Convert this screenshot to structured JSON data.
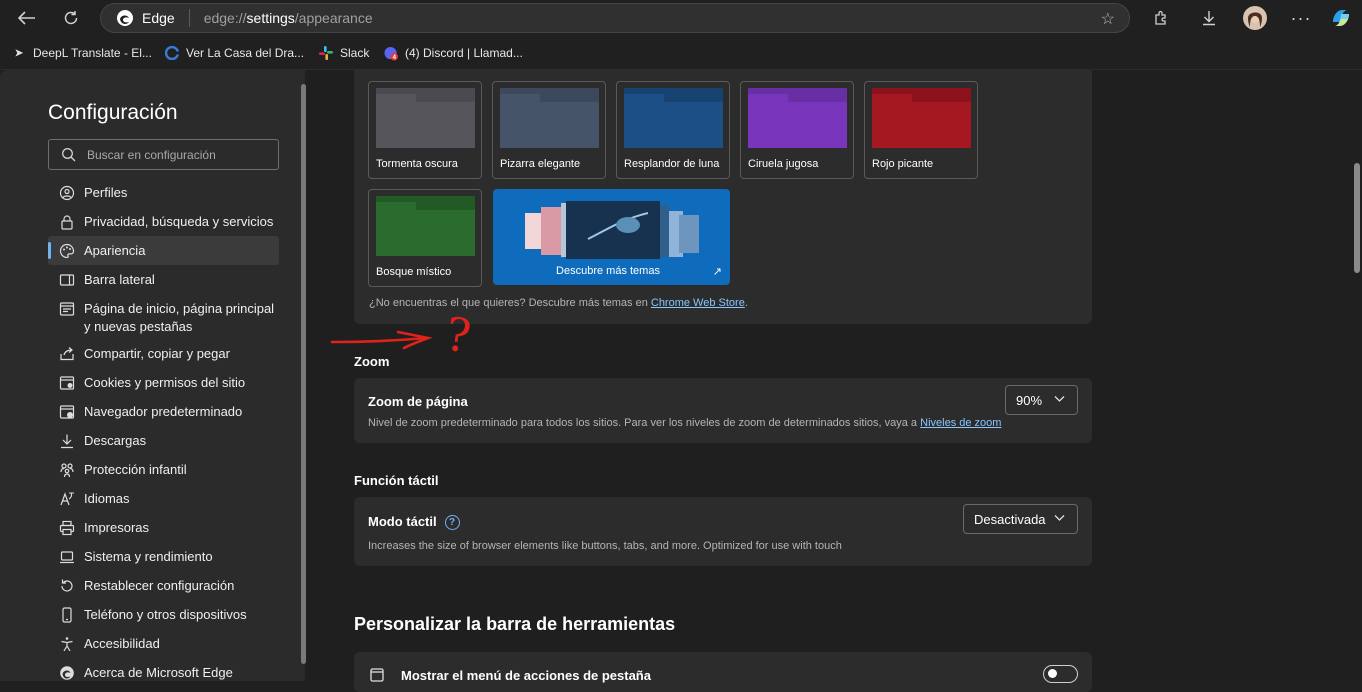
{
  "browser": {
    "brand": "Edge",
    "url_prefix": "edge://",
    "url_bold": "settings",
    "url_rest": "/appearance"
  },
  "favorites": [
    {
      "label": "DeepL Translate - El..."
    },
    {
      "label": "Ver La Casa del Dra..."
    },
    {
      "label": "Slack"
    },
    {
      "label": "(4) Discord | Llamad..."
    }
  ],
  "sidebar": {
    "title": "Configuración",
    "search_placeholder": "Buscar en configuración",
    "items": [
      {
        "label": "Perfiles",
        "icon": "profile-icon"
      },
      {
        "label": "Privacidad, búsqueda y servicios",
        "icon": "lock-icon"
      },
      {
        "label": "Apariencia",
        "icon": "palette-icon",
        "active": true
      },
      {
        "label": "Barra lateral",
        "icon": "sidebar-icon"
      },
      {
        "label": "Página de inicio, página principal y nuevas pestañas",
        "icon": "home-icon"
      },
      {
        "label": "Compartir, copiar y pegar",
        "icon": "share-icon"
      },
      {
        "label": "Cookies y permisos del sitio",
        "icon": "cookie-icon"
      },
      {
        "label": "Navegador predeterminado",
        "icon": "browser-icon"
      },
      {
        "label": "Descargas",
        "icon": "download-icon"
      },
      {
        "label": "Protección infantil",
        "icon": "family-icon"
      },
      {
        "label": "Idiomas",
        "icon": "language-icon"
      },
      {
        "label": "Impresoras",
        "icon": "printer-icon"
      },
      {
        "label": "Sistema y rendimiento",
        "icon": "laptop-icon"
      },
      {
        "label": "Restablecer configuración",
        "icon": "reset-icon"
      },
      {
        "label": "Teléfono y otros dispositivos",
        "icon": "phone-icon"
      },
      {
        "label": "Accesibilidad",
        "icon": "accessibility-icon"
      },
      {
        "label": "Acerca de Microsoft Edge",
        "icon": "edge-icon"
      }
    ]
  },
  "themes": {
    "items": [
      {
        "name": "Tormenta oscura",
        "color": "#55555b",
        "tab": "#4a4a50"
      },
      {
        "name": "Pizarra elegante",
        "color": "#46546a",
        "tab": "#3c485c"
      },
      {
        "name": "Resplandor de luna",
        "color": "#1b4f86",
        "tab": "#174373"
      },
      {
        "name": "Ciruela jugosa",
        "color": "#7a35bd",
        "tab": "#682ea3"
      },
      {
        "name": "Rojo picante",
        "color": "#a51822",
        "tab": "#8c131c"
      },
      {
        "name": "Bosque místico",
        "color": "#2a6b2e",
        "tab": "#225a26"
      }
    ],
    "discover_label": "Descubre más temas",
    "not_found_text": "¿No encuentras el que quieres? Descubre más temas en ",
    "store_link": "Chrome Web Store",
    "not_found_end": "."
  },
  "zoom": {
    "section_title": "Zoom",
    "card_title": "Zoom de página",
    "value": "90%",
    "desc": "Nivel de zoom predeterminado para todos los sitios. Para ver los niveles de zoom de determinados sitios, vaya a ",
    "link": "Niveles de zoom"
  },
  "touch": {
    "section_title": "Función táctil",
    "card_title": "Modo táctil",
    "value": "Desactivada",
    "desc": "Increases the size of browser elements like buttons, tabs, and more. Optimized for use with touch"
  },
  "toolbar": {
    "section_title": "Personalizar la barra de herramientas",
    "first_item": "Mostrar el menú de acciones de pestaña"
  },
  "annotation": {
    "color": "#e0221c",
    "symbol": "?"
  }
}
